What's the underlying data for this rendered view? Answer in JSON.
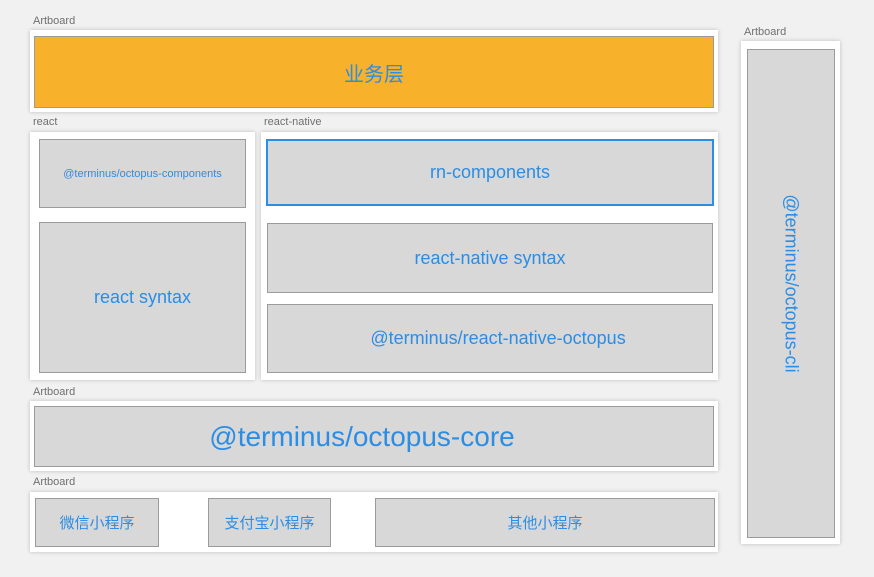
{
  "artboards": {
    "top_label": "Artboard",
    "react_label": "react",
    "react_native_label": "react-native",
    "core_label": "Artboard",
    "bottom_label": "Artboard",
    "right_label": "Artboard"
  },
  "layers": {
    "business": "业务层",
    "octopus_components": "@terminus/octopus-components",
    "react_syntax": "react syntax",
    "rn_components": "rn-components",
    "react_native_syntax": "react-native syntax",
    "react_native_octopus": "@terminus/react-native-octopus",
    "octopus_core": "@terminus/octopus-core",
    "octopus_cli": "@terminus/octopus-cli"
  },
  "mini_programs": {
    "wechat": "微信小程序",
    "alipay": "支付宝小程序",
    "others": "其他小程序"
  },
  "colors": {
    "accent_text": "#2b8de4",
    "business_fill": "#f7b12a",
    "box_fill": "#d8d8d8",
    "canvas": "#f1f1f1"
  }
}
